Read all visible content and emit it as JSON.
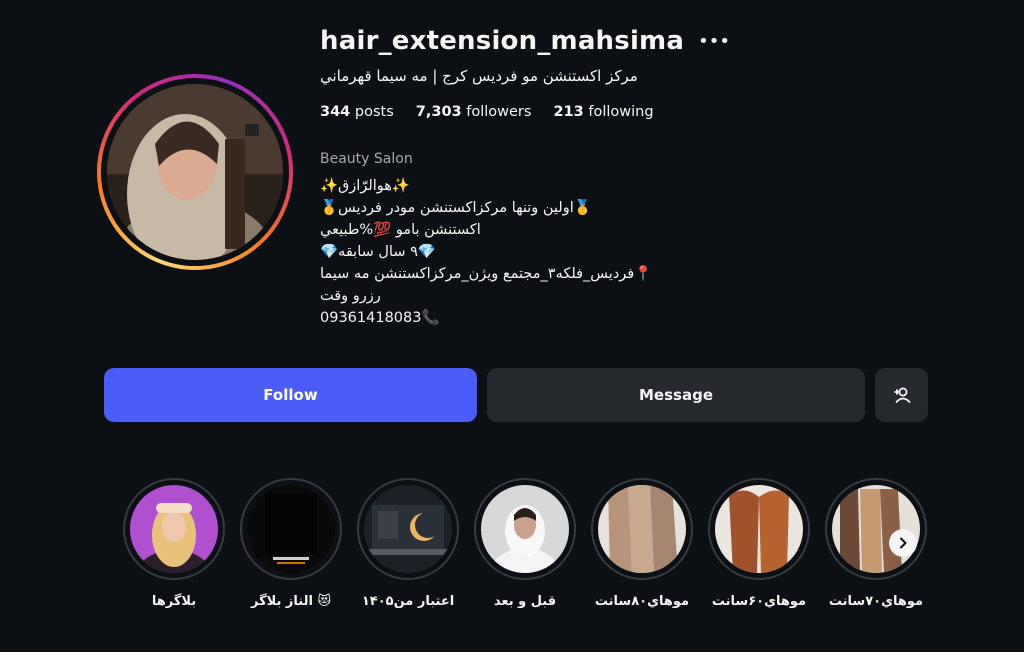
{
  "profile": {
    "username": "hair_extension_mahsima",
    "full_name": "مركز اكستنشن مو فرديس كرج | مه سيما قهرماني",
    "stats": {
      "posts_count": "344",
      "posts_label": "posts",
      "followers_count": "7,303",
      "followers_label": "followers",
      "following_count": "213",
      "following_label": "following"
    },
    "category": "Beauty Salon",
    "bio_lines": [
      "✨هوالرّازق✨",
      "🥇اولين وتنها مركزاكستنشن مودر فرديس🥇",
      "اكستنشن بامو 💯%طبيعي",
      "💎۹ سال سابقه💎",
      "📍فرديس_فلكه۳_مجتمع ويژن_مركزاكستنشن مه سيما",
      "رزرو وقت",
      "09361418083📞"
    ]
  },
  "actions": {
    "follow_label": "Follow",
    "message_label": "Message"
  },
  "highlights": [
    {
      "label": "بلاگرها",
      "icon": "blogger-photo"
    },
    {
      "label": "الناز بلاگر 😻",
      "icon": "video-thumbnail"
    },
    {
      "label": "اعتبار من۱۴۰۵",
      "icon": "laptop-photo"
    },
    {
      "label": "قبل و بعد",
      "icon": "portrait-photo"
    },
    {
      "label": "موهاي۸۰سانت",
      "icon": "hair-photo"
    },
    {
      "label": "موهاي۶۰سانت",
      "icon": "hair-photo"
    },
    {
      "label": "موهاي۷۰سانت",
      "icon": "hair-photo"
    }
  ],
  "colors": {
    "background": "#0c1014",
    "follow_button": "#4a5df9",
    "secondary_button": "#25292e",
    "muted_text": "#a8a8a8"
  }
}
